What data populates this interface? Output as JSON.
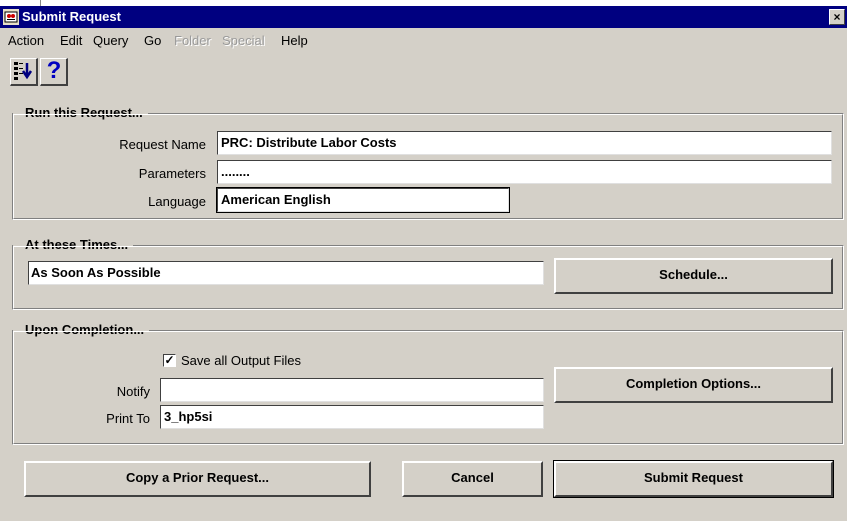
{
  "window": {
    "title": "Submit Request",
    "close_glyph": "×",
    "app_icon": "oracle-forms-icon"
  },
  "menu": {
    "items": [
      {
        "label": "Action",
        "enabled": true
      },
      {
        "label": "Edit",
        "enabled": true
      },
      {
        "label": "Query",
        "enabled": true
      },
      {
        "label": "Go",
        "enabled": true
      },
      {
        "label": "Folder",
        "enabled": false
      },
      {
        "label": "Special",
        "enabled": false
      },
      {
        "label": "Help",
        "enabled": true
      }
    ]
  },
  "toolbar": {
    "buttons": [
      {
        "icon": "list-of-values-icon"
      },
      {
        "icon": "help-icon",
        "glyph": "?"
      }
    ]
  },
  "run_group": {
    "title": "Run this Request...",
    "request_name_label": "Request Name",
    "request_name_value": "PRC: Distribute Labor Costs",
    "parameters_label": "Parameters",
    "parameters_value": "........",
    "language_label": "Language",
    "language_value": "American English"
  },
  "times_group": {
    "title": "At these Times...",
    "schedule_value": "As Soon As Possible",
    "schedule_button": "Schedule..."
  },
  "completion_group": {
    "title": "Upon Completion...",
    "save_output_label": "Save all Output Files",
    "save_output_checked": true,
    "check_glyph": "✓",
    "notify_label": "Notify",
    "notify_value": "",
    "print_to_label": "Print To",
    "print_to_value": "3_hp5si",
    "completion_options_button": "Completion Options..."
  },
  "footer": {
    "copy_button": "Copy a Prior Request...",
    "cancel_button": "Cancel",
    "submit_button": "Submit Request"
  },
  "colors": {
    "titlebar": "#000080",
    "dialog_bg": "#d4d0c8",
    "field_bg": "#ffffff",
    "disabled_text": "#9a9a9a"
  }
}
